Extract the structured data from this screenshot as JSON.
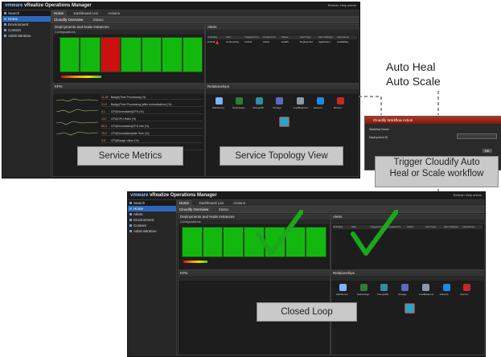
{
  "annotations": {
    "auto_heal": "Auto Heal",
    "auto_scale": "Auto Scale",
    "trigger_line1": "Trigger Cloudify Auto",
    "trigger_line2": "Heal or Scale workflow",
    "service_metrics": "Service Metrics",
    "service_topology": "Service Topology View",
    "closed_loop": "Closed Loop"
  },
  "app": {
    "title_prefix": "vmware",
    "title": "vRealize Operations Manager",
    "top_links": "Refresh   Help   admin",
    "search_placeholder": "Search"
  },
  "tabs": [
    "Home",
    "Dashboard List",
    "Actions"
  ],
  "dashboard_tabs": [
    "Cloudify Overview",
    "Status"
  ],
  "sidebar": {
    "items": [
      "Home",
      "Alerts",
      "Environment",
      "Content",
      "Administration"
    ]
  },
  "panels": {
    "deployments": "Deployments and Node Instances",
    "alerts": "Alerts",
    "kpis": "KPIs",
    "relationships": "Relationships",
    "configurations_label": "Configurations"
  },
  "top_heatmap": {
    "cells": [
      "green",
      "green",
      "red",
      "green",
      "green",
      "green",
      "green"
    ]
  },
  "bottom_heatmap": {
    "cells": [
      "green",
      "green",
      "green",
      "green",
      "green",
      "green",
      "green"
    ]
  },
  "alert_columns": [
    "Criticality",
    "Alert",
    "Triggered On",
    "Created On",
    "Status",
    "Alert Type",
    "Alert Subtype",
    "Importance"
  ],
  "alert_row": [
    "Critical",
    "Connectivity",
    "Critical",
    "Active",
    "Health",
    "Deployment",
    "Application",
    "Availability"
  ],
  "metrics": [
    {
      "name": "Badge|Time Processing (%)",
      "value": "11.45"
    },
    {
      "name": "Badge|Time Processing (after normalization) (%)",
      "value": "9.13"
    },
    {
      "name": "CPU|Normalized|CPU (%)",
      "value": "8.1"
    },
    {
      "name": "CPU|CPU Ratio (%)",
      "value": "13.7"
    },
    {
      "name": "CPU|Normalized|CPU Idle (%)",
      "value": "80.3"
    },
    {
      "name": "CPU|Normalized|Idle Time (%)",
      "value": "75.9"
    },
    {
      "name": "CPU|Badge Value (%)",
      "value": "4.5"
    },
    {
      "name": "Badge|The System Health|Badge (%)",
      "value": "96.1"
    }
  ],
  "topology_nodes": [
    "WebServer",
    "NodeJsApp",
    "MongoDB",
    "Storage",
    "LoadBalancer",
    "Network",
    "Monitor"
  ],
  "modal": {
    "title": "Cloudify Workflow Action",
    "field1": "Workflow Name",
    "field2": "Deployment ID",
    "button": "OK"
  },
  "colors": {
    "healthy": "#13b80f",
    "critical": "#cc0f0f",
    "check": "#1aa81a",
    "selected": "#2b69b8"
  }
}
